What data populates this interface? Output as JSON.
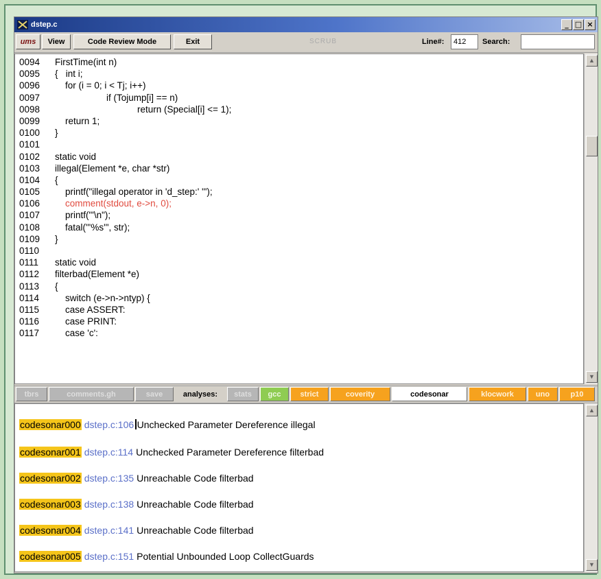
{
  "window": {
    "title": "dstep.c",
    "controls": [
      "_",
      "□",
      "×"
    ]
  },
  "toolbar": {
    "logo_label": "ums",
    "view_label": "View",
    "code_review_label": "Code Review Mode",
    "exit_label": "Exit",
    "scrub_label": "SCRUB",
    "lineno_label": "Line#:",
    "lineno_value": "412",
    "search_label": "Search:",
    "search_value": ""
  },
  "code_lines": [
    {
      "n": "0094",
      "t": "FirstTime(int n)",
      "hl": false
    },
    {
      "n": "0095",
      "t": "{   int i;",
      "hl": false
    },
    {
      "n": "0096",
      "t": "    for (i = 0; i < Tj; i++)",
      "hl": false
    },
    {
      "n": "0097",
      "t": "                    if (Tojump[i] == n)",
      "hl": false
    },
    {
      "n": "0098",
      "t": "                                return (Special[i] <= 1);",
      "hl": false
    },
    {
      "n": "0099",
      "t": "    return 1;",
      "hl": false
    },
    {
      "n": "0100",
      "t": "}",
      "hl": false
    },
    {
      "n": "0101",
      "t": "",
      "hl": false
    },
    {
      "n": "0102",
      "t": "static void",
      "hl": false
    },
    {
      "n": "0103",
      "t": "illegal(Element *e, char *str)",
      "hl": false
    },
    {
      "n": "0104",
      "t": "{",
      "hl": false
    },
    {
      "n": "0105",
      "t": "    printf(\"illegal operator in 'd_step:' '\");",
      "hl": false
    },
    {
      "n": "0106",
      "t": "    comment(stdout, e->n, 0);",
      "hl": true
    },
    {
      "n": "0107",
      "t": "    printf(\"'\\n\");",
      "hl": false
    },
    {
      "n": "0108",
      "t": "    fatal(\"'%s'\", str);",
      "hl": false
    },
    {
      "n": "0109",
      "t": "}",
      "hl": false
    },
    {
      "n": "0110",
      "t": "",
      "hl": false
    },
    {
      "n": "0111",
      "t": "static void",
      "hl": false
    },
    {
      "n": "0112",
      "t": "filterbad(Element *e)",
      "hl": false
    },
    {
      "n": "0113",
      "t": "{",
      "hl": false
    },
    {
      "n": "0114",
      "t": "    switch (e->n->ntyp) {",
      "hl": false
    },
    {
      "n": "0115",
      "t": "    case ASSERT:",
      "hl": false
    },
    {
      "n": "0116",
      "t": "    case PRINT:",
      "hl": false
    },
    {
      "n": "0117",
      "t": "    case 'c':",
      "hl": false
    }
  ],
  "tabs": [
    {
      "label": "tbrs",
      "style": "gray"
    },
    {
      "label": "comments.gh",
      "style": "gray"
    },
    {
      "label": "save",
      "style": "gray"
    },
    {
      "label": "analyses:",
      "style": "label"
    },
    {
      "label": "stats",
      "style": "gray"
    },
    {
      "label": "gcc",
      "style": "green"
    },
    {
      "label": "strict",
      "style": "orange"
    },
    {
      "label": "coverity",
      "style": "orange"
    },
    {
      "label": "codesonar",
      "style": "white"
    },
    {
      "label": "klocwork",
      "style": "orange"
    },
    {
      "label": "uno",
      "style": "orange"
    },
    {
      "label": "p10",
      "style": "orange"
    }
  ],
  "results": [
    {
      "tool": "codesonar000",
      "loc": "dstep.c:106",
      "msg": "Unchecked Parameter Dereference illegal"
    },
    {
      "tool": "codesonar001",
      "loc": "dstep.c:114",
      "msg": "Unchecked Parameter Dereference filterbad"
    },
    {
      "tool": "codesonar002",
      "loc": "dstep.c:135",
      "msg": "Unreachable Code filterbad"
    },
    {
      "tool": "codesonar003",
      "loc": "dstep.c:138",
      "msg": "Unreachable Code filterbad"
    },
    {
      "tool": "codesonar004",
      "loc": "dstep.c:141",
      "msg": "Unreachable Code filterbad"
    },
    {
      "tool": "codesonar005",
      "loc": "dstep.c:151",
      "msg": "Potential Unbounded Loop CollectGuards"
    }
  ],
  "colors": {
    "highlight_line": "#e04a3e",
    "tool_badge": "#f5c51a",
    "location_link": "#5a6fc8",
    "tab_orange": "#f6a21e",
    "tab_green": "#8fcc52"
  }
}
